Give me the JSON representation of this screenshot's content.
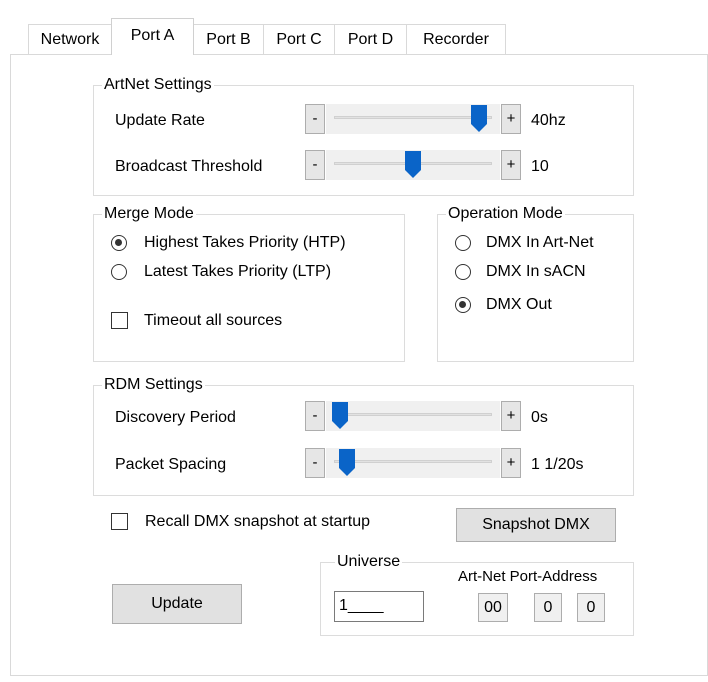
{
  "tabs": [
    {
      "label": "Network"
    },
    {
      "label": "Port A"
    },
    {
      "label": "Port B"
    },
    {
      "label": "Port C"
    },
    {
      "label": "Port D"
    },
    {
      "label": "Recorder"
    }
  ],
  "artnet": {
    "title": "ArtNet Settings",
    "update_rate": {
      "label": "Update Rate",
      "minus": "-",
      "plus": "+",
      "value": "40hz",
      "level": 0.95
    },
    "broadcast_threshold": {
      "label": "Broadcast Threshold",
      "minus": "-",
      "plus": "+",
      "value": "10",
      "level": 0.5
    }
  },
  "merge": {
    "title": "Merge Mode",
    "htp": "Highest Takes Priority (HTP)",
    "ltp": "Latest Takes Priority (LTP)",
    "timeout": "Timeout all sources",
    "selected": "htp"
  },
  "operation": {
    "title": "Operation Mode",
    "opt1": "DMX In Art-Net",
    "opt2": "DMX In sACN",
    "opt3": "DMX Out",
    "selected": "opt3"
  },
  "rdm": {
    "title": "RDM Settings",
    "discovery": {
      "label": "Discovery Period",
      "minus": "-",
      "plus": "+",
      "value": "0s",
      "level": 0.0
    },
    "spacing": {
      "label": "Packet Spacing",
      "minus": "-",
      "plus": "+",
      "value": "1 1/20s",
      "level": 0.05
    }
  },
  "recall": {
    "label": "Recall DMX snapshot at startup",
    "checked": false
  },
  "snapshot_button": "Snapshot DMX",
  "update_button": "Update",
  "universe": {
    "title": "Universe",
    "value": "1____",
    "port_address_label": "Art-Net Port-Address",
    "addr1": "00",
    "addr2": "0",
    "addr3": "0"
  },
  "colors": {
    "thumb": "#0a64c8"
  }
}
